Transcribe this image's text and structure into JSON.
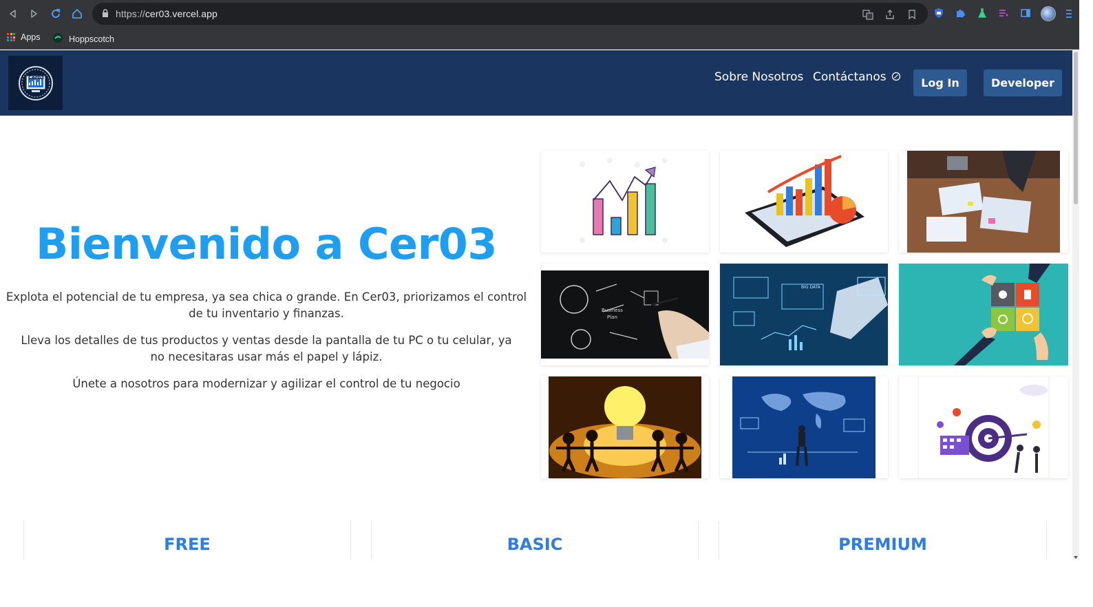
{
  "browser": {
    "url_scheme": "https://",
    "url_host": "cer03.vercel.app",
    "bookmarks": [
      {
        "label": "Apps",
        "icon": "apps-grid-icon"
      },
      {
        "label": "Hoppscotch",
        "icon": "hoppscotch-icon"
      }
    ]
  },
  "site": {
    "logo_text": "Cer03",
    "nav": {
      "about": "Sobre Nosotros",
      "contact": "Contáctanos",
      "login": "Log In",
      "developer": "Developer"
    },
    "hero": {
      "title": "Bienvenido a Cer03",
      "p1": "Explota el potencial de tu empresa, ya sea chica o grande. En Cer03, priorizamos el control de tu inventario y finanzas.",
      "p2": "Lleva los detalles de tus productos y ventas desde la pantalla de tu PC o tu celular, ya no necesitaras usar más el papel y lápiz.",
      "p3": "Únete a nosotros para modernizar y agilizar el control de tu negocio"
    },
    "gallery": [
      "growth-bar-chart-illustration",
      "tablet-3d-chart-image",
      "business-meeting-documents-photo",
      "business-plan-sketch-photo",
      "big-data-hologram-photo",
      "puzzle-hands-illustration",
      "lightbulb-teamwork-photo",
      "world-map-digital-photo",
      "target-business-illustration"
    ],
    "plans": [
      "FREE",
      "BASIC",
      "PREMIUM"
    ]
  },
  "colors": {
    "navbar": "#1a3660",
    "accent_title": "#1e9ef0",
    "plan_title": "#2f7de1",
    "button": "#2d5a91"
  }
}
